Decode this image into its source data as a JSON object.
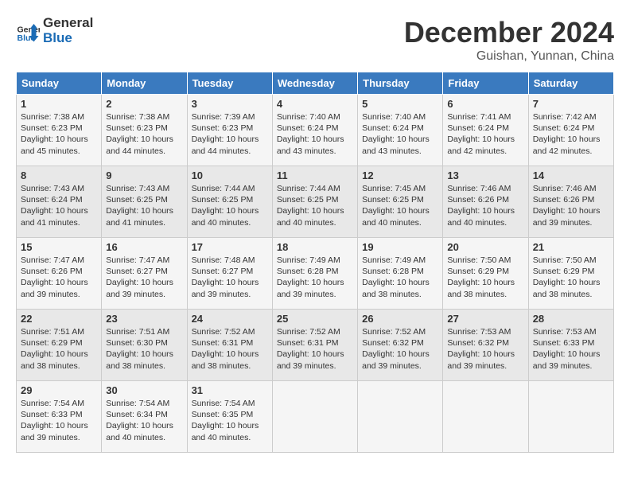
{
  "logo": {
    "line1": "General",
    "line2": "Blue"
  },
  "title": "December 2024",
  "location": "Guishan, Yunnan, China",
  "days_of_week": [
    "Sunday",
    "Monday",
    "Tuesday",
    "Wednesday",
    "Thursday",
    "Friday",
    "Saturday"
  ],
  "weeks": [
    [
      {
        "day": "1",
        "sunrise": "7:38 AM",
        "sunset": "6:23 PM",
        "daylight": "10 hours and 45 minutes."
      },
      {
        "day": "2",
        "sunrise": "7:38 AM",
        "sunset": "6:23 PM",
        "daylight": "10 hours and 44 minutes."
      },
      {
        "day": "3",
        "sunrise": "7:39 AM",
        "sunset": "6:23 PM",
        "daylight": "10 hours and 44 minutes."
      },
      {
        "day": "4",
        "sunrise": "7:40 AM",
        "sunset": "6:24 PM",
        "daylight": "10 hours and 43 minutes."
      },
      {
        "day": "5",
        "sunrise": "7:40 AM",
        "sunset": "6:24 PM",
        "daylight": "10 hours and 43 minutes."
      },
      {
        "day": "6",
        "sunrise": "7:41 AM",
        "sunset": "6:24 PM",
        "daylight": "10 hours and 42 minutes."
      },
      {
        "day": "7",
        "sunrise": "7:42 AM",
        "sunset": "6:24 PM",
        "daylight": "10 hours and 42 minutes."
      }
    ],
    [
      {
        "day": "8",
        "sunrise": "7:43 AM",
        "sunset": "6:24 PM",
        "daylight": "10 hours and 41 minutes."
      },
      {
        "day": "9",
        "sunrise": "7:43 AM",
        "sunset": "6:25 PM",
        "daylight": "10 hours and 41 minutes."
      },
      {
        "day": "10",
        "sunrise": "7:44 AM",
        "sunset": "6:25 PM",
        "daylight": "10 hours and 40 minutes."
      },
      {
        "day": "11",
        "sunrise": "7:44 AM",
        "sunset": "6:25 PM",
        "daylight": "10 hours and 40 minutes."
      },
      {
        "day": "12",
        "sunrise": "7:45 AM",
        "sunset": "6:25 PM",
        "daylight": "10 hours and 40 minutes."
      },
      {
        "day": "13",
        "sunrise": "7:46 AM",
        "sunset": "6:26 PM",
        "daylight": "10 hours and 40 minutes."
      },
      {
        "day": "14",
        "sunrise": "7:46 AM",
        "sunset": "6:26 PM",
        "daylight": "10 hours and 39 minutes."
      }
    ],
    [
      {
        "day": "15",
        "sunrise": "7:47 AM",
        "sunset": "6:26 PM",
        "daylight": "10 hours and 39 minutes."
      },
      {
        "day": "16",
        "sunrise": "7:47 AM",
        "sunset": "6:27 PM",
        "daylight": "10 hours and 39 minutes."
      },
      {
        "day": "17",
        "sunrise": "7:48 AM",
        "sunset": "6:27 PM",
        "daylight": "10 hours and 39 minutes."
      },
      {
        "day": "18",
        "sunrise": "7:49 AM",
        "sunset": "6:28 PM",
        "daylight": "10 hours and 39 minutes."
      },
      {
        "day": "19",
        "sunrise": "7:49 AM",
        "sunset": "6:28 PM",
        "daylight": "10 hours and 38 minutes."
      },
      {
        "day": "20",
        "sunrise": "7:50 AM",
        "sunset": "6:29 PM",
        "daylight": "10 hours and 38 minutes."
      },
      {
        "day": "21",
        "sunrise": "7:50 AM",
        "sunset": "6:29 PM",
        "daylight": "10 hours and 38 minutes."
      }
    ],
    [
      {
        "day": "22",
        "sunrise": "7:51 AM",
        "sunset": "6:29 PM",
        "daylight": "10 hours and 38 minutes."
      },
      {
        "day": "23",
        "sunrise": "7:51 AM",
        "sunset": "6:30 PM",
        "daylight": "10 hours and 38 minutes."
      },
      {
        "day": "24",
        "sunrise": "7:52 AM",
        "sunset": "6:31 PM",
        "daylight": "10 hours and 38 minutes."
      },
      {
        "day": "25",
        "sunrise": "7:52 AM",
        "sunset": "6:31 PM",
        "daylight": "10 hours and 39 minutes."
      },
      {
        "day": "26",
        "sunrise": "7:52 AM",
        "sunset": "6:32 PM",
        "daylight": "10 hours and 39 minutes."
      },
      {
        "day": "27",
        "sunrise": "7:53 AM",
        "sunset": "6:32 PM",
        "daylight": "10 hours and 39 minutes."
      },
      {
        "day": "28",
        "sunrise": "7:53 AM",
        "sunset": "6:33 PM",
        "daylight": "10 hours and 39 minutes."
      }
    ],
    [
      {
        "day": "29",
        "sunrise": "7:54 AM",
        "sunset": "6:33 PM",
        "daylight": "10 hours and 39 minutes."
      },
      {
        "day": "30",
        "sunrise": "7:54 AM",
        "sunset": "6:34 PM",
        "daylight": "10 hours and 40 minutes."
      },
      {
        "day": "31",
        "sunrise": "7:54 AM",
        "sunset": "6:35 PM",
        "daylight": "10 hours and 40 minutes."
      },
      null,
      null,
      null,
      null
    ]
  ],
  "labels": {
    "sunrise": "Sunrise:",
    "sunset": "Sunset:",
    "daylight": "Daylight:"
  }
}
